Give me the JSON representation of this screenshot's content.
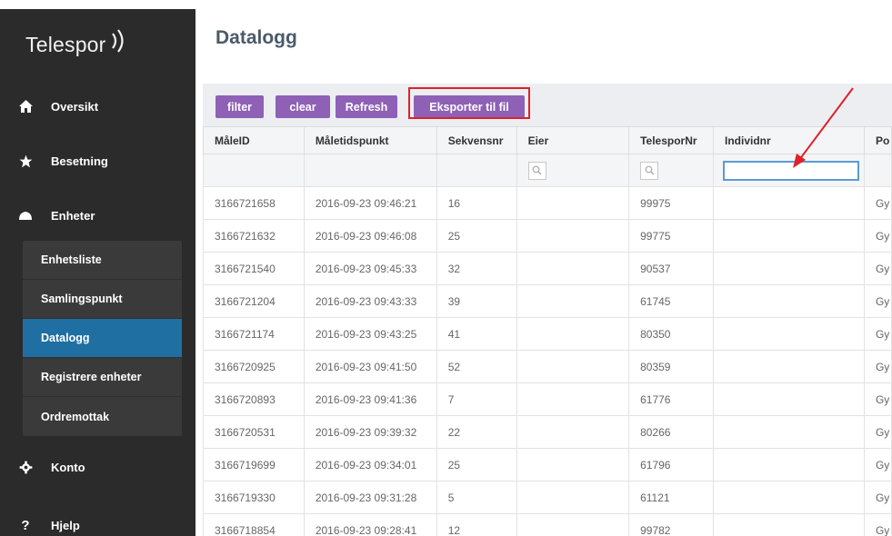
{
  "app": {
    "brand": "Telespor"
  },
  "nav": {
    "oversikt": "Oversikt",
    "besetning": "Besetning",
    "enheter": "Enheter",
    "sub": [
      "Enhetsliste",
      "Samlingspunkt",
      "Datalogg",
      "Registrere enheter",
      "Ordremottak"
    ],
    "konto": "Konto",
    "hjelp": "Hjelp",
    "active_sub": "Datalogg"
  },
  "page": {
    "title": "Datalogg"
  },
  "toolbar": {
    "filter": "filter",
    "clear": "clear",
    "refresh": "Refresh",
    "export": "Eksporter til fil"
  },
  "table": {
    "columns": [
      "MåleID",
      "Måletidspunkt",
      "Sekvensnr",
      "Eier",
      "TelesporNr",
      "Individnr",
      "Po"
    ],
    "filter_input_value": "",
    "rows": [
      [
        "3166721658",
        "2016-09-23 09:46:21",
        "16",
        "",
        "99975",
        "",
        "Gy"
      ],
      [
        "3166721632",
        "2016-09-23 09:46:08",
        "25",
        "",
        "99775",
        "",
        "Gy"
      ],
      [
        "3166721540",
        "2016-09-23 09:45:33",
        "32",
        "",
        "90537",
        "",
        "Gy"
      ],
      [
        "3166721204",
        "2016-09-23 09:43:33",
        "39",
        "",
        "61745",
        "",
        "Gy"
      ],
      [
        "3166721174",
        "2016-09-23 09:43:25",
        "41",
        "",
        "80350",
        "",
        "Gy"
      ],
      [
        "3166720925",
        "2016-09-23 09:41:50",
        "52",
        "",
        "80359",
        "",
        "Gy"
      ],
      [
        "3166720893",
        "2016-09-23 09:41:36",
        "7",
        "",
        "61776",
        "",
        "Gy"
      ],
      [
        "3166720531",
        "2016-09-23 09:39:32",
        "22",
        "",
        "80266",
        "",
        "Gy"
      ],
      [
        "3166719699",
        "2016-09-23 09:34:01",
        "25",
        "",
        "61796",
        "",
        "Gy"
      ],
      [
        "3166719330",
        "2016-09-23 09:31:28",
        "5",
        "",
        "61121",
        "",
        "Gy"
      ],
      [
        "3166718854",
        "2016-09-23 09:28:41",
        "12",
        "",
        "99782",
        "",
        "Gy"
      ]
    ]
  },
  "annotations": {
    "highlight_color": "#e0202a",
    "arrow_color": "#e0202a"
  },
  "colors": {
    "sidebar": "#2b2b2b",
    "active": "#1f6fa3",
    "button": "#8e60b6"
  }
}
